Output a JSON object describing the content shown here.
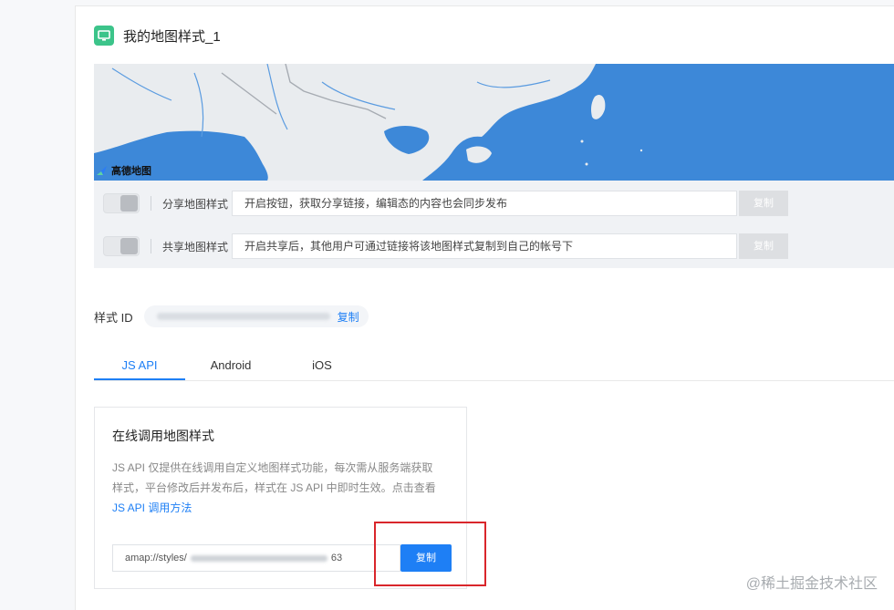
{
  "header": {
    "title": "我的地图样式_1",
    "icon": "monitor-icon"
  },
  "map": {
    "brand_label": "高德地图"
  },
  "share": [
    {
      "label": "分享地图样式",
      "text": "开启按钮，获取分享链接，编辑态的内容也会同步发布",
      "copy_label": "复制"
    },
    {
      "label": "共享地图样式",
      "text": "开启共享后，其他用户可通过链接将该地图样式复制到自己的帐号下",
      "copy_label": "复制"
    }
  ],
  "style_id": {
    "label": "样式 ID",
    "copy_label": "复制"
  },
  "tabs": [
    {
      "label": "JS API",
      "active": true
    },
    {
      "label": "Android",
      "active": false
    },
    {
      "label": "iOS",
      "active": false
    }
  ],
  "online": {
    "title": "在线调用地图样式",
    "desc": "JS API 仅提供在线调用自定义地图样式功能，每次需从服务端获取样式，平台修改后并发布后，样式在 JS API 中即时生效。点击查看 ",
    "link": "JS API 调用方法",
    "url_prefix": "amap://styles/",
    "url_suffix": "63",
    "copy_label": "复制"
  },
  "watermark": "@稀土掘金技术社区",
  "colors": {
    "accent": "#1e7ff5",
    "sea": "#3d88d8",
    "land": "#e9ecef",
    "highlight": "#d9262b"
  }
}
